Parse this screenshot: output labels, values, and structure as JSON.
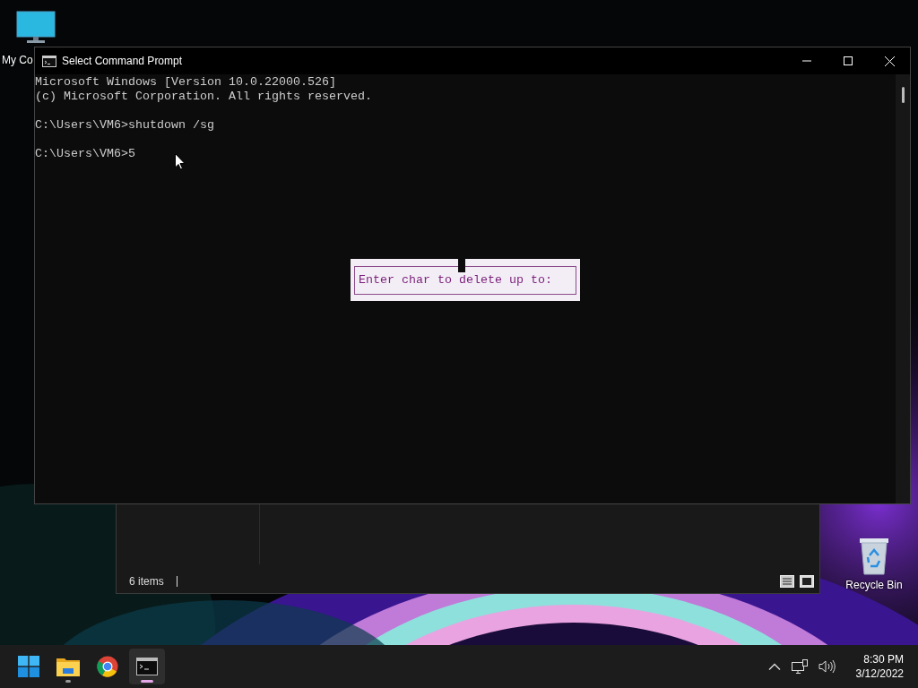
{
  "desktop_icons": [
    {
      "kind": "computer",
      "label": "My Co"
    },
    {
      "kind": "recycle",
      "label": "Recycle Bin"
    }
  ],
  "explorer_window": {
    "status": "6 items"
  },
  "cmd_window": {
    "title": "Select Command Prompt",
    "blocks": [
      [
        "Microsoft Windows [Version 10.0.22000.526]",
        "(c) Microsoft Corporation. All rights reserved."
      ],
      [
        "C:\\Users\\VM6>shutdown /sg"
      ],
      [
        "C:\\Users\\VM6>5"
      ]
    ],
    "dialog_text": "Enter char to delete up to:"
  },
  "taskbar": {
    "apps": [
      {
        "kind": "start",
        "running": false,
        "selected": false
      },
      {
        "kind": "explorer",
        "running": true,
        "selected": false
      },
      {
        "kind": "browser",
        "running": false,
        "selected": false
      },
      {
        "kind": "terminal",
        "running": true,
        "selected": true
      }
    ],
    "time": "8:30 PM",
    "date": "3/12/2022"
  }
}
